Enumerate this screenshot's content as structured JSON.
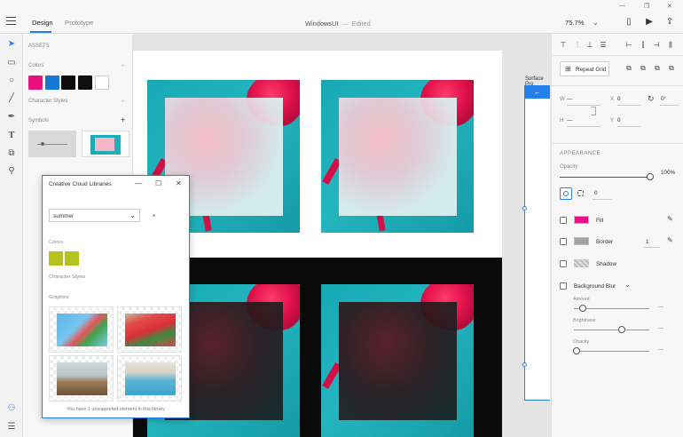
{
  "window": {
    "tabs": [
      "Design",
      "Prototype"
    ],
    "title": "WindowsUI",
    "separator": "—",
    "status": "Edited",
    "zoom": "75.7%",
    "controls": [
      "—",
      "❐",
      "✕"
    ]
  },
  "assets": {
    "heading": "ASSETS",
    "colors_label": "Colors",
    "colors": [
      "#ea1080",
      "#1778d2",
      "#0d0d0d",
      "#101010",
      "#ffffff"
    ],
    "character_styles_label": "Character Styles",
    "symbols_label": "Symbols",
    "add": "+"
  },
  "canvas": {
    "surface_label": "Surface Pro",
    "surface_back": "←"
  },
  "cclib": {
    "title": "Creative Cloud Libraries",
    "library": "summer",
    "colors_label": "Colors",
    "colors": [
      "#b8c31f",
      "#bcc41c"
    ],
    "character_styles_label": "Character Styles",
    "graphics_label": "Graphics",
    "footer": "You have 1 unsupported element in this library"
  },
  "props": {
    "repeat_grid": "Repeat Grid",
    "w_label": "W",
    "h_label": "H",
    "x_label": "X",
    "y_label": "Y",
    "w_value": "—",
    "h_value": "—",
    "x_value": "0",
    "y_value": "0",
    "rotation": "0°",
    "appearance_heading": "APPEARANCE",
    "opacity_label": "Opacity",
    "opacity_value": "100%",
    "corner_value": "0",
    "fill_label": "Fill",
    "fill_color": "#ea1080",
    "border_label": "Border",
    "border_color": "#a3a3a3",
    "border_width": "1",
    "shadow_label": "Shadow",
    "background_blur_label": "Background Blur",
    "amount_label": "Amount",
    "brightness_label": "Brightness",
    "blur_opacity_label": "Opacity",
    "dash": "—"
  }
}
